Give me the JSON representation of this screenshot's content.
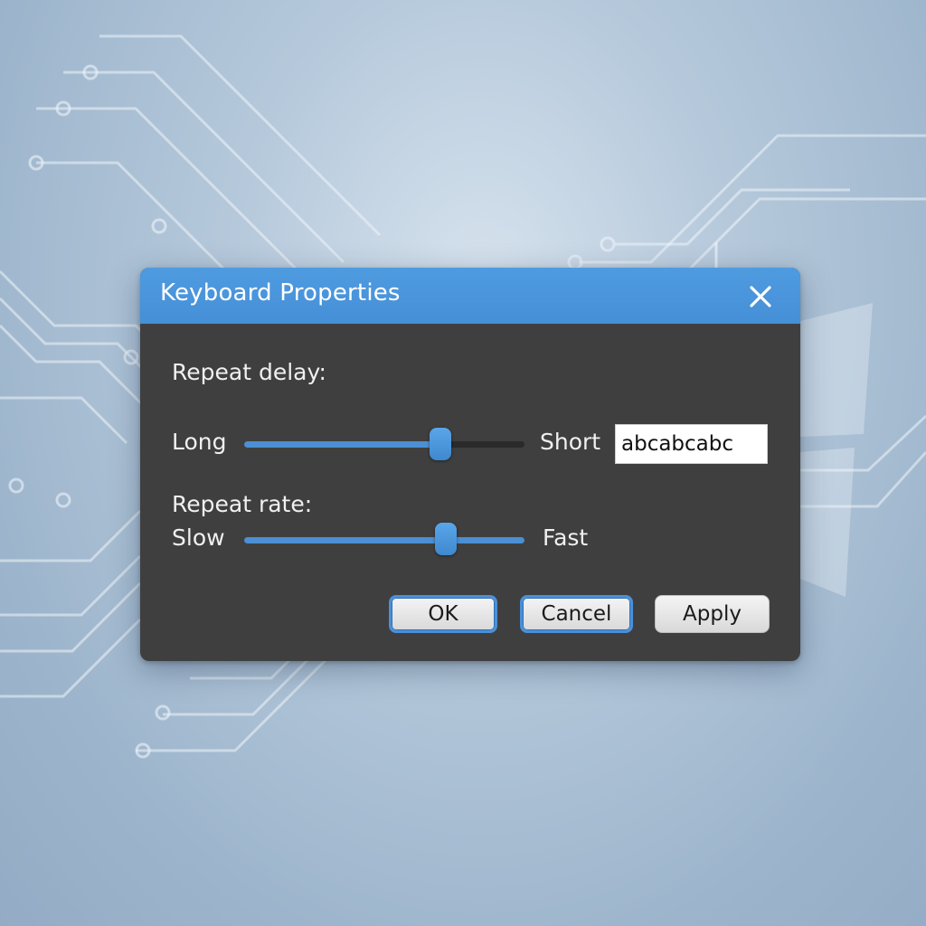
{
  "dialog": {
    "title": "Keyboard Properties",
    "close_icon": "close-icon"
  },
  "repeat_delay": {
    "heading": "Repeat delay:",
    "min_label": "Long",
    "max_label": "Short",
    "value_fraction": 0.7
  },
  "repeat_rate": {
    "heading": "Repeat rate:",
    "min_label": "Slow",
    "max_label": "Fast",
    "value_fraction": 0.72
  },
  "test_field": {
    "value": "abcabcabc"
  },
  "buttons": {
    "ok": "OK",
    "cancel": "Cancel",
    "apply": "Apply"
  },
  "colors": {
    "accent": "#4a90d9",
    "dialog_body": "#3f3f3f",
    "titlebar": "#4a95dc"
  }
}
